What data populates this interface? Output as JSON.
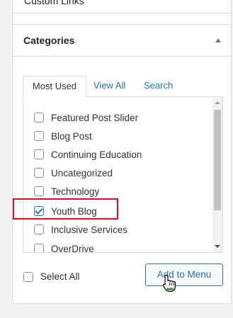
{
  "previous_section": {
    "title": "Custom Links"
  },
  "categories": {
    "title": "Categories",
    "tabs": [
      {
        "label": "Most Used",
        "active": true
      },
      {
        "label": "View All",
        "active": false
      },
      {
        "label": "Search",
        "active": false
      }
    ],
    "items": [
      {
        "label": "Featured Post Slider",
        "checked": false
      },
      {
        "label": "Blog Post",
        "checked": false
      },
      {
        "label": "Continuing Education",
        "checked": false
      },
      {
        "label": "Uncategorized",
        "checked": false
      },
      {
        "label": "Technology",
        "checked": false
      },
      {
        "label": "Youth Blog",
        "checked": true
      },
      {
        "label": "Inclusive Services",
        "checked": false
      },
      {
        "label": "OverDrive",
        "checked": false
      }
    ],
    "select_all_label": "Select All",
    "add_button_label": "Add to Menu"
  },
  "colors": {
    "link": "#2271b1",
    "highlight": "#e0101a",
    "border": "#dcdcde"
  },
  "icons": {
    "collapse": "triangle-up-icon",
    "cursor": "hand-pointer-icon"
  }
}
